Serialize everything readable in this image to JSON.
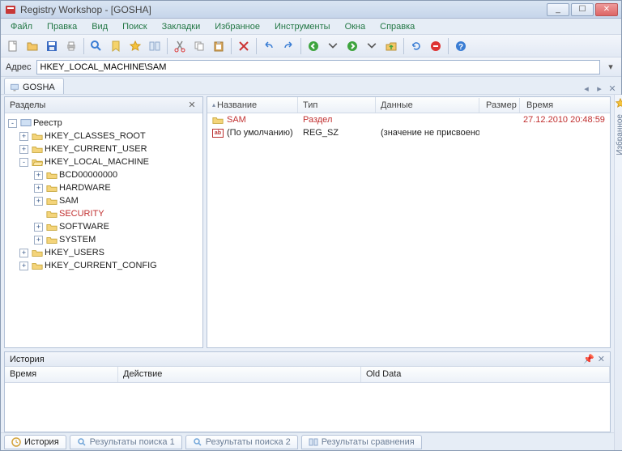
{
  "window": {
    "title": "Registry Workshop - [GOSHA]"
  },
  "menus": [
    "Файл",
    "Правка",
    "Вид",
    "Поиск",
    "Закладки",
    "Избранное",
    "Инструменты",
    "Окна",
    "Справка"
  ],
  "address": {
    "label": "Адрес",
    "value": "HKEY_LOCAL_MACHINE\\SAM"
  },
  "doc_tab": {
    "label": "GOSHA"
  },
  "right_sidebar": {
    "label": "Избранное"
  },
  "tree": {
    "header": "Разделы",
    "root": "Реестр",
    "hives": [
      {
        "label": "HKEY_CLASSES_ROOT",
        "exp": "+"
      },
      {
        "label": "HKEY_CURRENT_USER",
        "exp": "+"
      },
      {
        "label": "HKEY_LOCAL_MACHINE",
        "exp": "-",
        "children": [
          {
            "label": "BCD00000000",
            "exp": "+"
          },
          {
            "label": "HARDWARE",
            "exp": "+"
          },
          {
            "label": "SAM",
            "exp": "+"
          },
          {
            "label": "SECURITY",
            "exp": "",
            "red": true
          },
          {
            "label": "SOFTWARE",
            "exp": "+"
          },
          {
            "label": "SYSTEM",
            "exp": "+"
          }
        ]
      },
      {
        "label": "HKEY_USERS",
        "exp": "+"
      },
      {
        "label": "HKEY_CURRENT_CONFIG",
        "exp": "+"
      }
    ]
  },
  "list": {
    "columns": {
      "name": "Название",
      "type": "Тип",
      "data": "Данные",
      "size": "Размер",
      "time": "Время"
    },
    "rows": [
      {
        "icon": "folder",
        "name": "SAM",
        "type": "Раздел",
        "data": "",
        "size": "",
        "time": "27.12.2010 20:48:59",
        "red": true
      },
      {
        "icon": "string",
        "name": "(По умолчанию)",
        "type": "REG_SZ",
        "data": "(значение не присвоено)",
        "size": "",
        "time": ""
      }
    ]
  },
  "history": {
    "title": "История",
    "columns": {
      "time": "Время",
      "action": "Действие",
      "old": "Old Data"
    }
  },
  "bottom_tabs": [
    {
      "label": "История",
      "active": true,
      "icon": "history"
    },
    {
      "label": "Результаты поиска 1",
      "icon": "search"
    },
    {
      "label": "Результаты поиска 2",
      "icon": "search"
    },
    {
      "label": "Результаты сравнения",
      "icon": "compare"
    }
  ]
}
